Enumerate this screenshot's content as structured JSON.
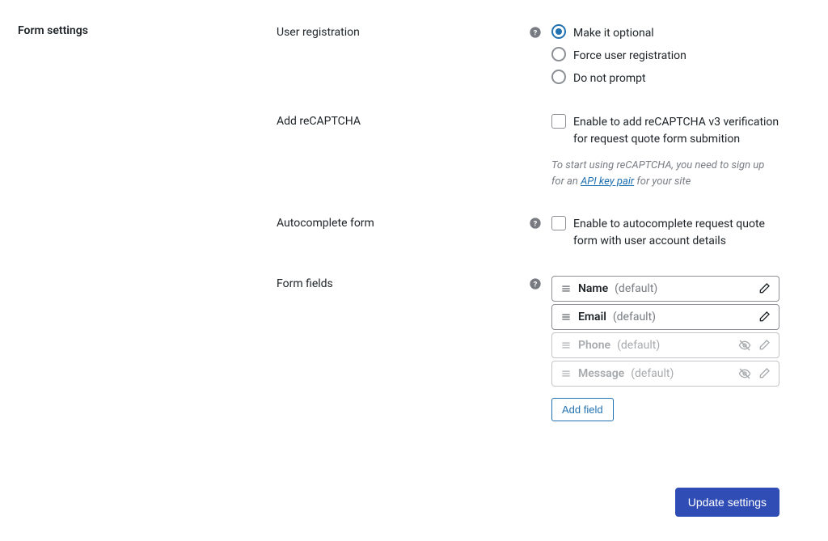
{
  "section_title": "Form settings",
  "rows": {
    "user_registration": {
      "label": "User registration",
      "options": {
        "optional": "Make it optional",
        "force": "Force user registration",
        "no_prompt": "Do not prompt"
      },
      "selected": "optional"
    },
    "recaptcha": {
      "label": "Add reCAPTCHA",
      "checkbox_label": "Enable to add reCAPTCHA v3 verification for request quote form submition",
      "helper_prefix": "To start using reCAPTCHA, you need to sign up for an ",
      "helper_link": "API key pair",
      "helper_suffix": " for your site"
    },
    "autocomplete": {
      "label": "Autocomplete form",
      "checkbox_label": "Enable to autocomplete request quote form with user account details"
    },
    "form_fields": {
      "label": "Form fields",
      "fields": [
        {
          "name": "Name",
          "suffix": "(default)",
          "muted": false,
          "hidden_icon": false
        },
        {
          "name": "Email",
          "suffix": "(default)",
          "muted": false,
          "hidden_icon": false
        },
        {
          "name": "Phone",
          "suffix": "(default)",
          "muted": true,
          "hidden_icon": true
        },
        {
          "name": "Message",
          "suffix": "(default)",
          "muted": true,
          "hidden_icon": true
        }
      ],
      "add_button": "Add field"
    }
  },
  "footer": {
    "update_button": "Update settings"
  }
}
